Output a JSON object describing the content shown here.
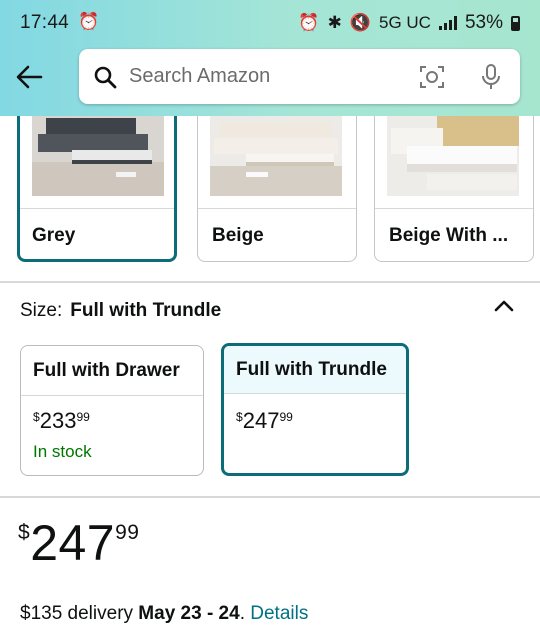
{
  "status_bar": {
    "time": "17:44",
    "network": "5G UC",
    "battery": "53%",
    "alarm_icon": "alarm-clock-icon"
  },
  "search": {
    "placeholder": "Search Amazon"
  },
  "colors": {
    "header_gradient_start": "#82d8e3",
    "header_gradient_end": "#a6e6cf",
    "selected_border": "#0c6d78",
    "in_stock": "#007600",
    "link": "#007185"
  },
  "color_swatches": [
    {
      "label": "Grey",
      "selected": true
    },
    {
      "label": "Beige",
      "selected": false
    },
    {
      "label": "Beige With ...",
      "selected": false
    }
  ],
  "size": {
    "label": "Size:",
    "value": "Full with Trundle"
  },
  "size_options": [
    {
      "name": "Full with Drawer",
      "currency": "$",
      "whole": "233",
      "fraction": "99",
      "stock": "In stock",
      "selected": false
    },
    {
      "name": "Full with Trundle",
      "currency": "$",
      "whole": "247",
      "fraction": "99",
      "selected": true
    }
  ],
  "price": {
    "currency": "$",
    "whole": "247",
    "fraction": "99"
  },
  "delivery": {
    "prefix": "$135 delivery ",
    "date": "May 23 - 24",
    "separator": ". ",
    "details_link": "Details"
  }
}
